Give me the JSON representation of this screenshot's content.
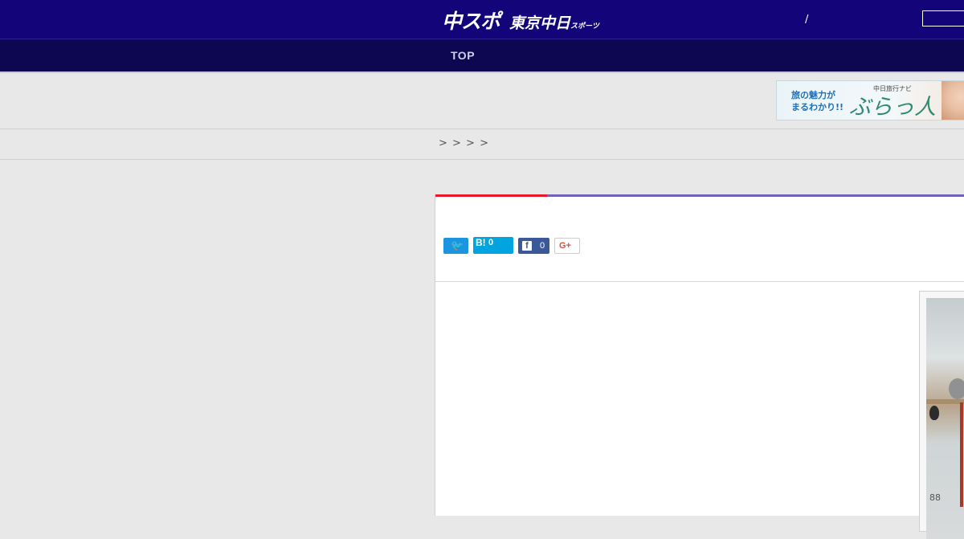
{
  "header": {
    "logo_main": "中スポ",
    "logo_sub": "東京中日",
    "logo_tiny": "スポーツ",
    "slash": "/"
  },
  "nav": {
    "top_label": "TOP"
  },
  "ad": {
    "text_line1": "旅の魅力が",
    "text_line2": "まるわかり!!",
    "small": "中日旅行ナビ",
    "brand": "ぶらっ人"
  },
  "breadcrumb": {
    "text": "> > > >"
  },
  "social": {
    "twitter_icon": "twitter-bird",
    "hatena_label": "B!",
    "hatena_count": "0",
    "facebook_icon": "f",
    "facebook_count": "0",
    "googleplus_label": "G+"
  },
  "photo": {
    "visible_text": "88"
  },
  "colors": {
    "header_bg": "#14047a",
    "nav_bg": "#0d0650",
    "accent_red": "#e51b2a",
    "accent_purple": "#6e63b6",
    "twitter": "#1b95e0",
    "hatena": "#00a4de",
    "facebook": "#3b5998"
  }
}
